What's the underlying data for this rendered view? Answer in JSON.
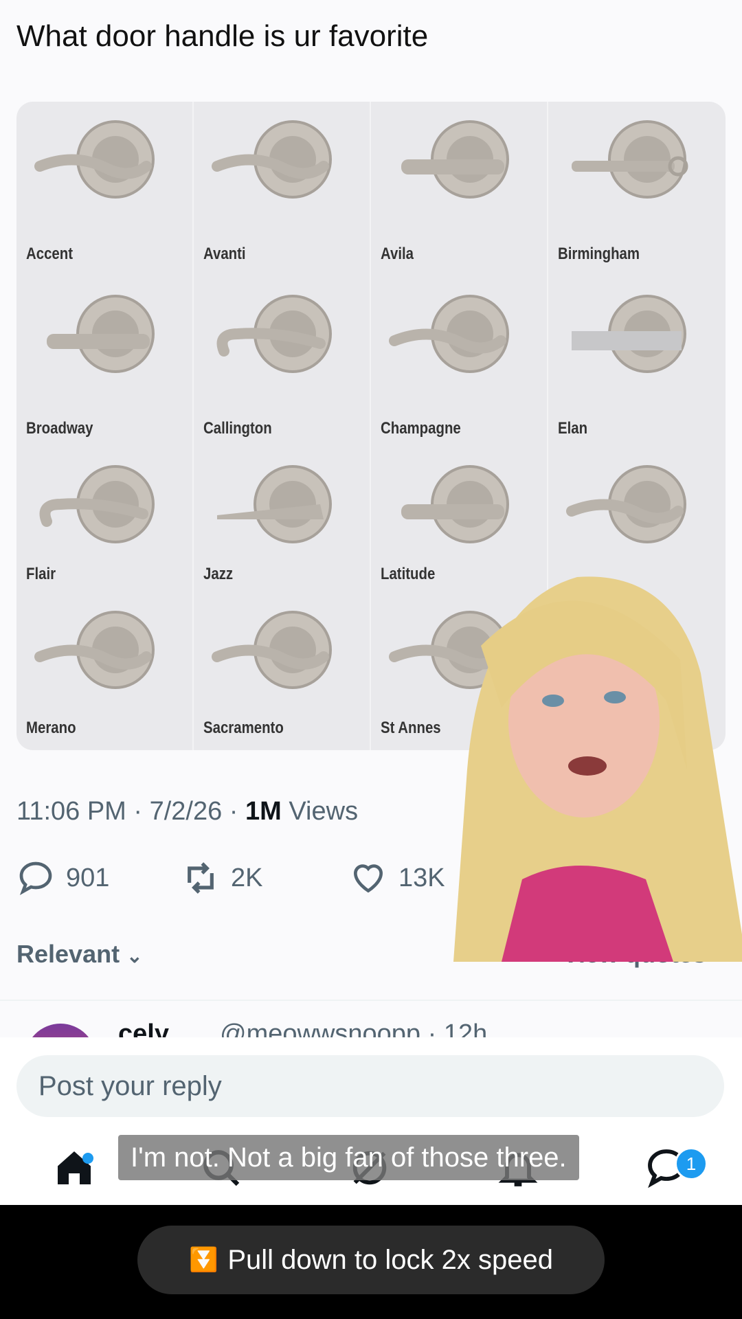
{
  "tweet": {
    "text": "What door handle is ur favorite"
  },
  "handles": [
    {
      "name": "Accent",
      "style": "curve"
    },
    {
      "name": "Avanti",
      "style": "curve"
    },
    {
      "name": "Avila",
      "style": "straight"
    },
    {
      "name": "Birmingham",
      "style": "ornate"
    },
    {
      "name": "Broadway",
      "style": "straight"
    },
    {
      "name": "Callington",
      "style": "scroll"
    },
    {
      "name": "Champagne",
      "style": "curve"
    },
    {
      "name": "Elan",
      "style": "square"
    },
    {
      "name": "Flair",
      "style": "scroll"
    },
    {
      "name": "Jazz",
      "style": "taper"
    },
    {
      "name": "Latitude",
      "style": "straight"
    },
    {
      "name": "",
      "style": "curve"
    },
    {
      "name": "Merano",
      "style": "curve"
    },
    {
      "name": "Sacramento",
      "style": "curve"
    },
    {
      "name": "St Annes",
      "style": "curve"
    },
    {
      "name": "",
      "style": "none"
    }
  ],
  "meta": {
    "time": "11:06 PM · 7/2/26 · ",
    "views_count": "1M",
    "views_label": " Views"
  },
  "actions": {
    "replies": "901",
    "reposts": "2K",
    "likes": "13K"
  },
  "sort": {
    "label": "Relevant"
  },
  "quotes": {
    "label": "View quotes"
  },
  "reply_peek": {
    "name": "cely",
    "handle": "@meowwsnoopp · 12h"
  },
  "reply_box": {
    "placeholder": "Post your reply"
  },
  "nav": {
    "message_badge": "1"
  },
  "caption": {
    "text": "I'm not. Not a big fan of those three."
  },
  "speed_pill": {
    "text": "Pull down to lock 2x speed"
  },
  "colors": {
    "accent": "#1d9bf0",
    "muted": "#536471"
  }
}
